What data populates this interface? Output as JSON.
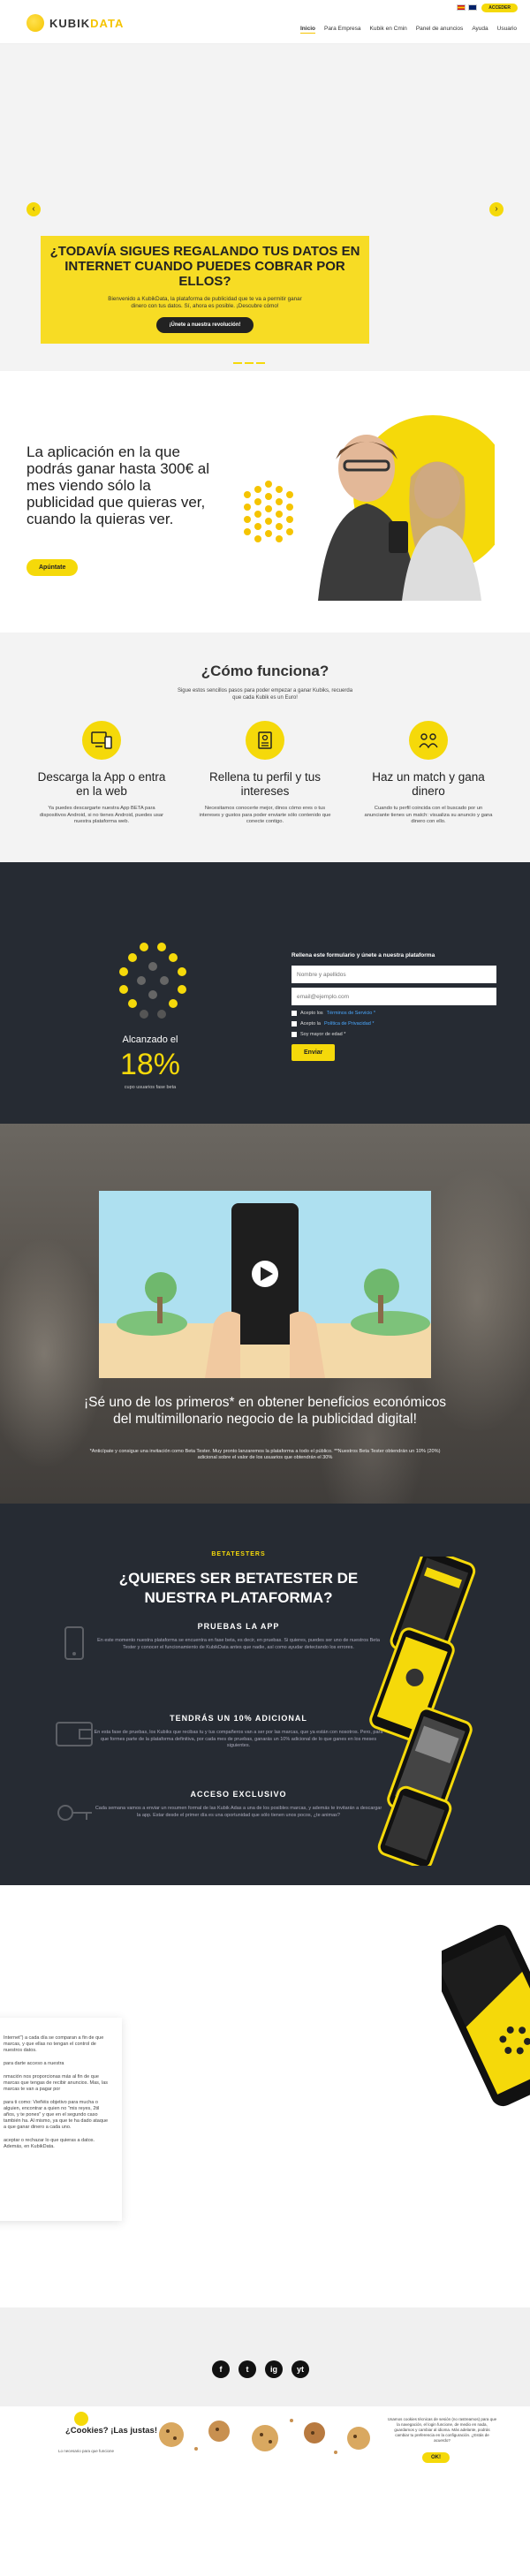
{
  "header": {
    "logo_prefix": "KUBIK",
    "logo_suffix": "DATA",
    "nav": [
      "Inicio",
      "Para Empresa",
      "Kubik en Cmin",
      "Panel de anuncios",
      "Ayuda",
      "Usuario"
    ],
    "acceder": "ACCEDER"
  },
  "hero": {
    "prev": "‹",
    "next": "›",
    "title": "¿TODAVÍA SIGUES REGALANDO TUS DATOS EN INTERNET CUANDO PUEDES COBRAR POR ELLOS?",
    "text": "Bienvenido a KubikData, la plataforma de publicidad que te va a permitir ganar dinero con tus datos. Sí, ahora es posible. ¡Descubre cómo!",
    "button": "¡Únete a nuestra revolución!"
  },
  "app": {
    "title": "La aplicación en la que podrás ganar hasta 300€ al mes viendo sólo la publicidad que quieras ver, cuando la quieras ver.",
    "button": "Apúntate"
  },
  "how": {
    "title": "¿Cómo funciona?",
    "subtitle": "Sigue estos sencillos pasos para poder empezar a ganar Kubiks, recuerda que cada Kubik es un Euro!",
    "steps": [
      {
        "title": "Descarga la App o entra en la web",
        "text": "Ya puedes descargarte nuestra App BETA para dispositivos Android, si no tienes Android, puedes usar nuestra plataforma web."
      },
      {
        "title": "Rellena tu perfil y tus intereses",
        "text": "Necesitamos conocerte mejor, dinos cómo eres o tus intereses y gustos para poder enviarte sólo contenido que conecte contigo."
      },
      {
        "title": "Haz un match y gana dinero",
        "text": "Cuando tu perfil coincida con el buscado por un anunciante tienes un match: visualiza su anuncio y gana dinero con ello."
      }
    ]
  },
  "signup": {
    "label": "Alcanzado el",
    "percent": "18%",
    "note": "cupo usuarios fase beta",
    "form_title": "Rellena este formulario y únete a nuestra plataforma",
    "name_placeholder": "Nombre y apellidos",
    "email_placeholder": "email@ejemplo.com",
    "check1_prefix": "Acepto los",
    "check1_link": "Términos de Servicio *",
    "check2_prefix": "Acepto la",
    "check2_link": "Política de Privacidad *",
    "check3": "Soy mayor de edad *",
    "submit": "Enviar"
  },
  "video": {
    "title": "¡Sé uno de los primeros* en obtener beneficios económicos del multimillonario negocio de la publicidad digital!",
    "note": "*Anticípate y consigue una invitación como Beta Tester. Muy pronto lanzaremos la plataforma a todo el público. **Nuestros Beta Tester obtendrán un 10% (20%) adicional sobre el valor de los usuarios que obtendrán el 30%"
  },
  "beta": {
    "kicker": "BETATESTERS",
    "title": "¿QUIERES SER BETATESTER DE NUESTRA PLATAFORMA?",
    "blocks": [
      {
        "title": "PRUEBAS LA APP",
        "text": "En este momento nuestra plataforma se encuentra en fase beta, es decir, en pruebas. Si quieres, puedes ser uno de nuestros Beta Tester y conocer el funcionamiento de KubikData antes que nadie, así como ayudar detectando los errores."
      },
      {
        "title": "TENDRÁS UN 10% ADICIONAL",
        "text": "En esta fase de pruebas, los Kubiks que recibas tu y tus compañeros van a ser por las marcas, que ya están con nosotros. Pero, para que formes parte de la plataforma definitiva, por cada mes de pruebas, ganarás un 10% adicional de lo que ganes en los meses siguientes."
      },
      {
        "title": "ACCESO EXCLUSIVO",
        "text": "Cada semana vamos a enviar un resumen formal de las Kubik Adas a una de los posibles marcas, y además te invitarán a descargar la app. Estar desde el primer día es una oportunidad que sólo tienen unos pocos, ¿te animas?"
      }
    ]
  },
  "game": {
    "paragraphs": [
      "Internet\") a cada día se comparan a fin de que marcas, y que ellas no tengan el control de nuestros datos.",
      "para darte acceso a nuestra",
      "nmación nos proporcionas más al fin de que marcas que tengas de recibir anuncios. Mas, las marcas te van a pagar por",
      "para ti como: Vieñéis objetivo para mucha o alguien, encontrar a quien no \"mis reyes, 2til años, y te pones\" y que en el segundo caso también ha. Al mismo, ya que te ha dado ataque a que ganar dinero a cada uno.",
      "aceptar o rechazar lo que quieras a datos. Además, en KubikData."
    ]
  },
  "footer": {
    "socials": [
      "f",
      "t",
      "ig",
      "yt"
    ],
    "cookie_title": "¿Cookies? ¡Las justas!",
    "cookie_note": "Lo necesario para que funcione",
    "cookie_text": "Usamos cookies técnicas de sesión (no rastreamos) para que la navegación, el login funcione, de medio en nada, guardamos y cambiar al idioma. Más adelante, podrás cambiar tu preferencia en la configuración. ¿Estás de acuerdo?",
    "cookie_button": "OK!"
  },
  "colors": {
    "brand_yellow": "#f5d90a",
    "dark": "#262b33"
  }
}
